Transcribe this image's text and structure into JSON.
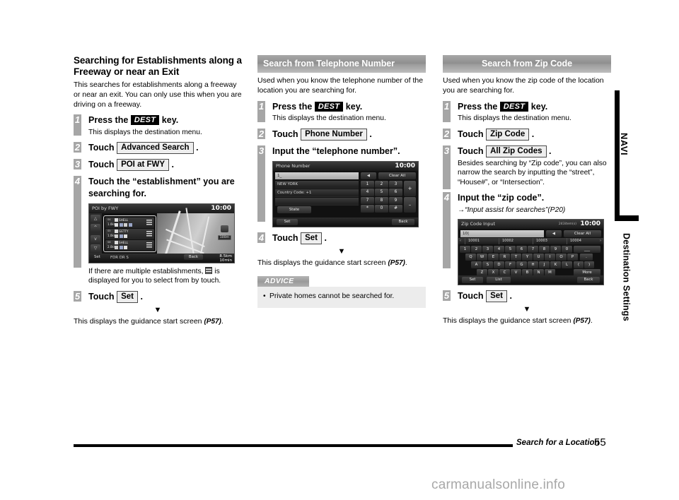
{
  "column1": {
    "chapter_title": "Searching for Establishments along a Freeway or near an Exit",
    "intro": "This searches for establishments along a freeway or near an exit. You can only use this when you are driving on a freeway.",
    "steps": [
      {
        "num": "1",
        "title_before": "Press the",
        "chip": "DEST",
        "title_after": "key.",
        "sub": "This displays the destination menu."
      },
      {
        "num": "2",
        "title_before": "Touch",
        "chip": "Advanced Search",
        "title_after": "."
      },
      {
        "num": "3",
        "title_before": "Touch",
        "chip": "POI at FWY",
        "title_after": "."
      },
      {
        "num": "4",
        "title": "Touch the “establishment” you are searching for.",
        "note_before": "If there are multiple establishments,",
        "note_after": "is displayed for you to select from by touch."
      },
      {
        "num": "5",
        "title_before": "Touch",
        "chip": "Set",
        "title_after": "."
      }
    ],
    "arrow": "▼",
    "result": "This displays the guidance start screen",
    "result_ref": "(P57)",
    "result_end": ".",
    "poi_screen": {
      "title": "POI by FWY",
      "clock": "10:00",
      "rows": [
        {
          "label": "S4",
          "dist": "1.0km",
          "name": "SHELL"
        },
        {
          "label": "S5",
          "dist": "1.0km",
          "name": "GETTY"
        },
        {
          "label": "S6",
          "dist": "2.0km",
          "name": "SHELL"
        }
      ],
      "set": "Set",
      "street": "FDR DR S",
      "back": "Back",
      "distance": "8.5km",
      "time": "10min",
      "scale": "100m"
    }
  },
  "column2": {
    "header": "Search from Telephone Number",
    "intro": "Used when you know the telephone number of the location you are searching for.",
    "steps": [
      {
        "num": "1",
        "title_before": "Press the",
        "chip": "DEST",
        "title_after": "key.",
        "sub": "This displays the destination menu."
      },
      {
        "num": "2",
        "title_before": "Touch",
        "chip": "Phone Number",
        "title_after": "."
      },
      {
        "num": "3",
        "title": "Input the “telephone number”."
      },
      {
        "num": "4",
        "title_before": "Touch",
        "chip": "Set",
        "title_after": "."
      }
    ],
    "arrow": "▼",
    "result": "This displays the guidance start screen",
    "result_ref": "(P57)",
    "result_end": ".",
    "advice": {
      "head": "ADVICE",
      "bullet": "•",
      "text": "Private homes cannot be searched for."
    },
    "phone_screen": {
      "title": "Phone Number",
      "clock": "10:00",
      "input": "1_",
      "back_arrow": "◀",
      "clear_all": "Clear All",
      "region": "NEW YORK",
      "country_code": "Country Code: +1",
      "state_button": "State",
      "keys": [
        "1",
        "2",
        "3",
        "4",
        "5",
        "6",
        "7",
        "8",
        "9",
        "*",
        "0",
        "#"
      ],
      "plus": "+",
      "minus": "–",
      "set": "Set",
      "back": "Back"
    }
  },
  "column3": {
    "header": "Search from Zip Code",
    "intro": "Used when you know the zip code of the location you are searching for.",
    "steps": [
      {
        "num": "1",
        "title_before": "Press the",
        "chip": "DEST",
        "title_after": "key.",
        "sub": "This displays the destination menu."
      },
      {
        "num": "2",
        "title_before": "Touch",
        "chip": "Zip Code",
        "title_after": "."
      },
      {
        "num": "3",
        "title_before": "Touch",
        "chip": "All Zip Codes",
        "title_after": ".",
        "sub": "Besides searching by “Zip code”, you can also narrow the search by inputting the “street”, “House#”, or “Intersection”."
      },
      {
        "num": "4",
        "title": "Input the “zip code”.",
        "ref": "→“Input assist for searches”(P20)"
      },
      {
        "num": "5",
        "title_before": "Touch",
        "chip": "Set",
        "title_after": "."
      }
    ],
    "arrow": "▼",
    "result": "This displays the guidance start screen",
    "result_ref": "(P57)",
    "result_end": ".",
    "zip_screen": {
      "title": "Zip Code Input",
      "clock": "10:00",
      "count": "243item(s)",
      "input": "10|",
      "back_arrow": "◀",
      "clear_all": "Clear All",
      "suggestions": [
        "10001",
        "10002",
        "10003",
        "10004"
      ],
      "arrow_left": "‹",
      "arrow_right": "›",
      "row_num": [
        "1",
        "2",
        "3",
        "4",
        "5",
        "6",
        "7",
        "8",
        "9",
        "0"
      ],
      "space_key": "___",
      "row_q": [
        "Q",
        "W",
        "E",
        "R",
        "T",
        "Y",
        "U",
        "I",
        "O",
        "P"
      ],
      "dot_key": ".",
      "row_a": [
        "A",
        "S",
        "D",
        "F",
        "G",
        "H",
        "J",
        "K",
        "L"
      ],
      "paren_open": "(",
      "paren_close": ")",
      "row_z": [
        "Z",
        "X",
        "C",
        "V",
        "B",
        "N",
        "M"
      ],
      "more": "More",
      "set": "Set",
      "list": "List",
      "back": "Back"
    }
  },
  "sidetab": {
    "navi": "NAVI",
    "destination": "Destination Settings"
  },
  "footer": {
    "text": "Search for a Location",
    "page": "55"
  },
  "watermark": "carmanualsonline.info"
}
